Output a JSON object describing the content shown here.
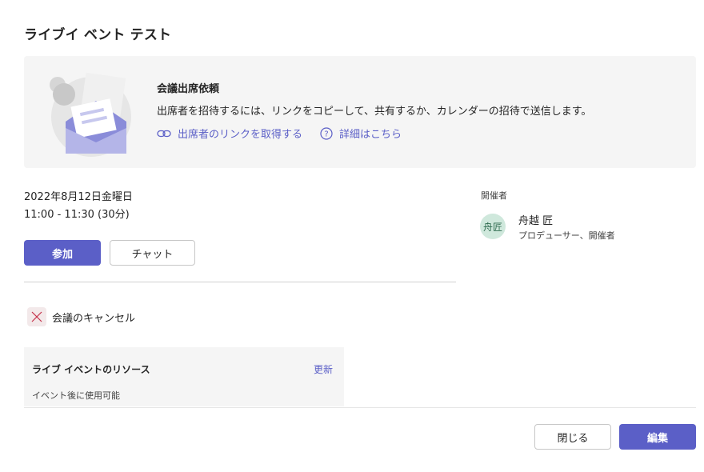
{
  "dialog": {
    "title": "ライブイ ベント テスト"
  },
  "banner": {
    "title": "会議出席依頼",
    "description": "出席者を招待するには、リンクをコピーして、共有するか、カレンダーの招待で送信します。",
    "invite_link_label": "出席者のリンクを取得する",
    "details_link_label": "詳細はこちら"
  },
  "meeting": {
    "date": "2022年8月12日金曜日",
    "time": "11:00 - 11:30 (30分)",
    "join_label": "参加",
    "chat_label": "チャット",
    "cancel_label": "会議のキャンセル"
  },
  "resources": {
    "title": "ライブ イベントのリソース",
    "update_label": "更新",
    "note": "イベント後に使用可能"
  },
  "organizer": {
    "heading": "開催者",
    "avatar_initials": "舟匠",
    "name": "舟越 匠",
    "role": "プロデューサー、開催者"
  },
  "footer": {
    "close_label": "閉じる",
    "edit_label": "編集"
  },
  "colors": {
    "accent": "#5b5fc7",
    "avatar_bg": "#cfe8dc",
    "cancel_icon": "#c4314b"
  },
  "icons": {
    "illustration": "envelope-invite-illustration",
    "invite": "link-icon",
    "details": "question-circle-icon",
    "cancel": "close-icon"
  }
}
